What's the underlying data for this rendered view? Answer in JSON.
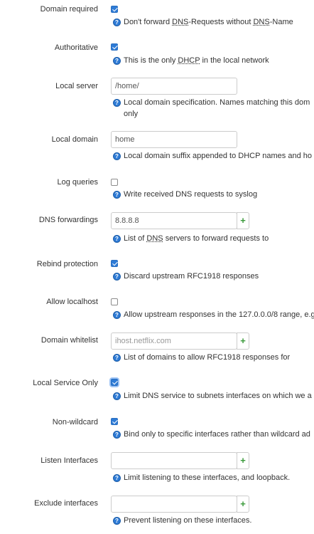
{
  "fields": {
    "domain_required": {
      "label": "Domain required",
      "checked": true,
      "help": "Don't forward DNS-Requests without DNS-Name"
    },
    "authoritative": {
      "label": "Authoritative",
      "checked": true,
      "help": "This is the only DHCP in the local network"
    },
    "local_server": {
      "label": "Local server",
      "value": "/home/",
      "help_line1": "Local domain specification. Names matching this dom",
      "help_line2": "only"
    },
    "local_domain": {
      "label": "Local domain",
      "value": "home",
      "help": "Local domain suffix appended to DHCP names and ho"
    },
    "log_queries": {
      "label": "Log queries",
      "checked": false,
      "help": "Write received DNS requests to syslog"
    },
    "dns_forwardings": {
      "label": "DNS forwardings",
      "value": "8.8.8.8",
      "help": "List of DNS servers to forward requests to"
    },
    "rebind_protection": {
      "label": "Rebind protection",
      "checked": true,
      "help": "Discard upstream RFC1918 responses"
    },
    "allow_localhost": {
      "label": "Allow localhost",
      "checked": false,
      "help": "Allow upstream responses in the 127.0.0.0/8 range, e.g"
    },
    "domain_whitelist": {
      "label": "Domain whitelist",
      "placeholder": "ihost.netflix.com",
      "help": "List of domains to allow RFC1918 responses for"
    },
    "local_service_only": {
      "label": "Local Service Only",
      "checked": true,
      "help": "Limit DNS service to subnets interfaces on which we a"
    },
    "non_wildcard": {
      "label": "Non-wildcard",
      "checked": true,
      "help": "Bind only to specific interfaces rather than wildcard ad"
    },
    "listen_interfaces": {
      "label": "Listen Interfaces",
      "value": "",
      "help": "Limit listening to these interfaces, and loopback."
    },
    "exclude_interfaces": {
      "label": "Exclude interfaces",
      "value": "",
      "help": "Prevent listening on these interfaces."
    }
  },
  "add_button_label": "+",
  "help_icon_glyph": "?",
  "colors": {
    "checkbox_checked": "#2e7bd6",
    "add_icon": "#3a9a3a",
    "text": "#333333"
  }
}
